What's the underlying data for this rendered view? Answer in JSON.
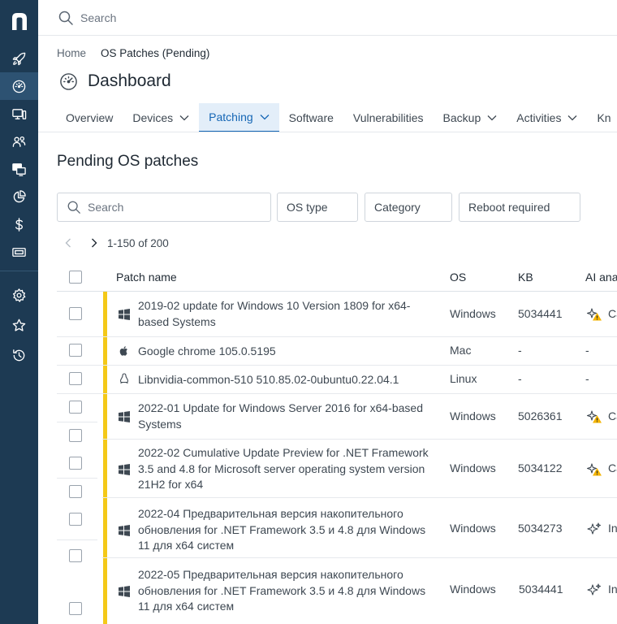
{
  "sidebar": {
    "logo": "n",
    "items": [
      {
        "icon": "rocket-icon",
        "active": false
      },
      {
        "icon": "dashboard-gauge-icon",
        "active": true
      },
      {
        "icon": "devices-icon",
        "active": false
      },
      {
        "icon": "users-icon",
        "active": false
      },
      {
        "icon": "remote-screens-icon",
        "active": false
      },
      {
        "icon": "pie-chart-icon",
        "active": false
      },
      {
        "icon": "dollar-icon",
        "active": false
      },
      {
        "icon": "ticket-icon",
        "active": false
      },
      {
        "icon": "gear-icon",
        "active": false
      },
      {
        "icon": "star-icon",
        "active": false
      },
      {
        "icon": "history-icon",
        "active": false
      }
    ]
  },
  "topbar": {
    "search_placeholder": "Search"
  },
  "breadcrumb": {
    "home": "Home",
    "current": "OS Patches (Pending)"
  },
  "page": {
    "title": "Dashboard"
  },
  "tabs": [
    {
      "label": "Overview",
      "dropdown": false,
      "active": false
    },
    {
      "label": "Devices",
      "dropdown": true,
      "active": false
    },
    {
      "label": "Patching",
      "dropdown": true,
      "active": true
    },
    {
      "label": "Software",
      "dropdown": false,
      "active": false
    },
    {
      "label": "Vulnerabilities",
      "dropdown": false,
      "active": false
    },
    {
      "label": "Backup",
      "dropdown": true,
      "active": false
    },
    {
      "label": "Activities",
      "dropdown": true,
      "active": false
    },
    {
      "label": "Kn",
      "dropdown": false,
      "active": false
    }
  ],
  "section": {
    "title": "Pending OS patches"
  },
  "filters": {
    "search_placeholder": "Search",
    "os_type": "OS type",
    "category": "Category",
    "reboot": "Reboot required"
  },
  "pager": {
    "range": "1-150 of 200"
  },
  "table": {
    "headers": {
      "patch_name": "Patch name",
      "os": "OS",
      "kb": "KB",
      "ai": "AI ana"
    },
    "rows": [
      {
        "name": "2019-02 update for Windows 10 Version 1809 for x64-based Systems",
        "os_icon": "windows-icon",
        "os": "Windows",
        "kb": "5034441",
        "ai_icon": "sparkle-warning-icon",
        "ai_text": "Ca"
      },
      {
        "name": "Google chrome 105.0.5195",
        "os_icon": "apple-icon",
        "os": "Mac",
        "kb": "-",
        "ai_icon": "",
        "ai_text": "-"
      },
      {
        "name": "Libnvidia-common-510 510.85.02-0ubuntu0.22.04.1",
        "os_icon": "linux-icon",
        "os": "Linux",
        "kb": "-",
        "ai_icon": "",
        "ai_text": "-"
      },
      {
        "name": "2022-01 Update for Windows Server 2016 for x64-based Systems",
        "os_icon": "windows-icon",
        "os": "Windows",
        "kb": "5026361",
        "ai_icon": "sparkle-warning-icon",
        "ai_text": "Ca"
      },
      {
        "name": "2022-02 Cumulative Update Preview for .NET Framework 3.5 and 4.8 for Microsoft server operating system version 21H2 for x64",
        "os_icon": "windows-icon",
        "os": "Windows",
        "kb": "5034122",
        "ai_icon": "sparkle-warning-icon",
        "ai_text": "Ca"
      },
      {
        "name": "2022-04 Предварительная версия накопительного обновления for .NET Framework 3.5 и 4.8 для Windows 11 для x64 систем",
        "os_icon": "windows-icon",
        "os": "Windows",
        "kb": "5034273",
        "ai_icon": "sparkle-icon",
        "ai_text": "In"
      },
      {
        "name": "2022-05 Предварительная версия накопительного обновления for .NET Framework 3.5 и 4.8 для Windows 11 для x64 систем",
        "os_icon": "windows-icon",
        "os": "Windows",
        "kb": "5034441",
        "ai_icon": "sparkle-icon",
        "ai_text": "In"
      }
    ]
  },
  "colors": {
    "sidebar": "#1d3a53",
    "sidebar_active": "#2d5272",
    "accent": "#1566b5",
    "active_tab_bg": "#e3eef9",
    "pending_bar": "#f4c918",
    "warning": "#f4b400"
  }
}
